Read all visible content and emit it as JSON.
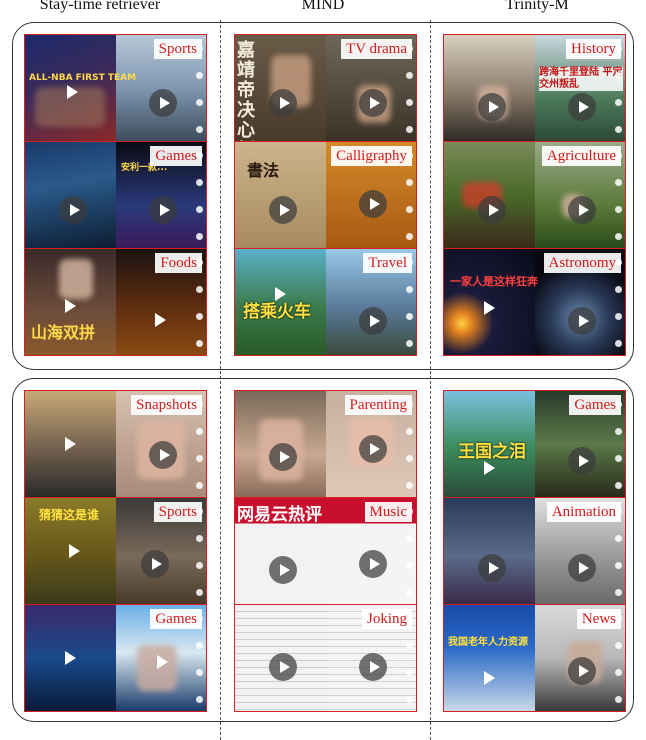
{
  "columns": [
    "Stay-time retriever",
    "MIND",
    "Trinity-M"
  ],
  "groups": [
    {
      "panels": [
        {
          "label": "Sports",
          "overlay": "ALL-NBA FIRST TEAM"
        },
        {
          "label": "TV drama",
          "overlay": "嘉靖帝决心倒"
        },
        {
          "label": "History",
          "overlay": "跨海千里登陆 平定交州叛乱"
        },
        {
          "label": "Games",
          "overlay": "安利一款..."
        },
        {
          "label": "Calligraphy",
          "overlay": ""
        },
        {
          "label": "Agriculture",
          "overlay": ""
        },
        {
          "label": "Foods",
          "overlay": "山海双拼"
        },
        {
          "label": "Travel",
          "overlay": "搭乘火车"
        },
        {
          "label": "Astronomy",
          "overlay": "一家人是这样狂奔"
        }
      ]
    },
    {
      "panels": [
        {
          "label": "Snapshots",
          "overlay": ""
        },
        {
          "label": "Parenting",
          "overlay": ""
        },
        {
          "label": "Games",
          "overlay": "王国之泪"
        },
        {
          "label": "Sports",
          "overlay": "猜猜这是谁"
        },
        {
          "label": "Music",
          "overlay": "网易云热评"
        },
        {
          "label": "Animation",
          "overlay": ""
        },
        {
          "label": "Games",
          "overlay": ""
        },
        {
          "label": "Joking",
          "overlay": ""
        },
        {
          "label": "News",
          "overlay": "我国老年人力资源"
        }
      ]
    }
  ],
  "colors": {
    "tag_text": "#d21c1c",
    "panel_border": "#d62020"
  }
}
